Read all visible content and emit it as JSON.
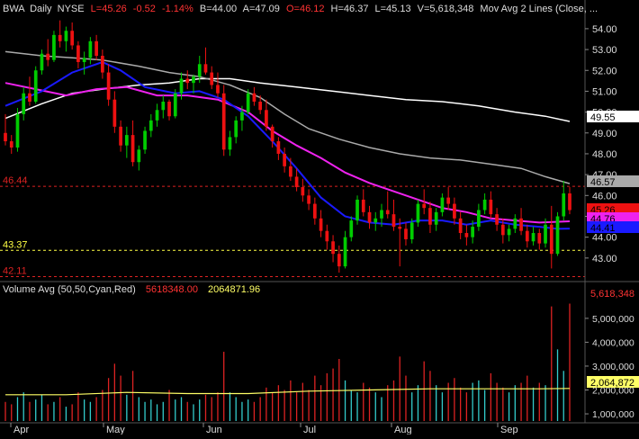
{
  "header": {
    "symbol": "BWA",
    "interval": "Daily",
    "exchange": "NYSE",
    "last": "L=45.26",
    "change": "-0.52",
    "change_pct": "-1.14%",
    "bid": "B=44.00",
    "ask": "A=47.09",
    "open": "O=46.12",
    "high": "H=46.37",
    "low": "L=45.13",
    "volume": "V=5,618,348",
    "study": "Mov Avg 2 Lines (Close, ..."
  },
  "volume_header": {
    "label": "Volume Avg (50,50,Cyan,Red)",
    "value1": "5618348.00",
    "value2": "2064871.96"
  },
  "colors": {
    "background": "#000000",
    "up_candle": "#00cc00",
    "down_candle": "#ee1111",
    "ma_blue": "#1a1aff",
    "ma_magenta": "#ee22ee",
    "ma_grey": "#aaaaaa",
    "ma_white": "#ffffff",
    "volume_up": "#33cccc",
    "volume_down": "#dd2222",
    "volume_avg": "#ffff66",
    "level_red": "#dd2222",
    "level_yellow": "#ffff44"
  },
  "chart_data": {
    "type": "candlestick",
    "price_axis": {
      "ylim": [
        42.0,
        54.6
      ],
      "ticks": [
        43,
        44,
        45,
        46,
        47,
        48,
        49,
        50,
        51,
        52,
        53,
        54
      ],
      "tick_labels": [
        "43.00",
        "44.00",
        "45.00",
        "46.00",
        "47.00",
        "48.00",
        "49.00",
        "50.00",
        "51.00",
        "52.00",
        "53.00",
        "54.00"
      ]
    },
    "x_axis": {
      "months": [
        "Apr",
        "May",
        "Jun",
        "Jul",
        "Aug",
        "Sep"
      ]
    },
    "level_lines": [
      {
        "value": 46.44,
        "label": "46.44",
        "color": "red"
      },
      {
        "value": 43.37,
        "label": "43.37",
        "color": "yellow"
      },
      {
        "value": 42.11,
        "label": "42.11",
        "color": "red"
      }
    ],
    "value_tags": [
      {
        "value": 49.55,
        "label": "49.55",
        "bg": "#ffffff",
        "fg": "#000000"
      },
      {
        "value": 46.57,
        "label": "46.57",
        "bg": "#aaaaaa",
        "fg": "#000000"
      },
      {
        "value": 45.26,
        "label": "45.26",
        "bg": "#ee1111",
        "fg": "#000000"
      },
      {
        "value": 44.76,
        "label": "44.76",
        "bg": "#ee22ee",
        "fg": "#000000"
      },
      {
        "value": 44.41,
        "label": "44.41",
        "bg": "#1a1aff",
        "fg": "#000000"
      }
    ],
    "candles_ohlc": [
      [
        49.0,
        49.9,
        48.4,
        48.6
      ],
      [
        48.6,
        48.9,
        48.0,
        48.3
      ],
      [
        48.3,
        50.2,
        48.1,
        49.9
      ],
      [
        49.9,
        51.2,
        49.6,
        50.9
      ],
      [
        50.9,
        51.7,
        50.3,
        50.5
      ],
      [
        50.5,
        52.2,
        50.4,
        52.0
      ],
      [
        52.0,
        53.0,
        51.8,
        52.8
      ],
      [
        52.8,
        53.5,
        52.2,
        52.5
      ],
      [
        52.5,
        53.9,
        52.4,
        53.7
      ],
      [
        53.7,
        54.4,
        53.1,
        53.4
      ],
      [
        53.4,
        54.1,
        52.9,
        53.9
      ],
      [
        53.9,
        54.3,
        53.0,
        53.2
      ],
      [
        53.2,
        53.4,
        52.1,
        52.4
      ],
      [
        52.4,
        52.9,
        51.8,
        52.6
      ],
      [
        52.6,
        53.6,
        52.3,
        53.4
      ],
      [
        53.4,
        53.7,
        52.5,
        52.7
      ],
      [
        52.7,
        53.0,
        51.6,
        51.9
      ],
      [
        51.9,
        52.3,
        50.3,
        50.6
      ],
      [
        50.6,
        51.0,
        49.0,
        49.3
      ],
      [
        49.3,
        49.6,
        48.1,
        48.4
      ],
      [
        48.4,
        49.3,
        47.8,
        48.9
      ],
      [
        48.9,
        49.6,
        47.4,
        47.6
      ],
      [
        47.6,
        48.4,
        47.2,
        48.2
      ],
      [
        48.2,
        49.3,
        48.0,
        49.1
      ],
      [
        49.1,
        49.9,
        48.8,
        49.6
      ],
      [
        49.6,
        50.4,
        49.3,
        50.1
      ],
      [
        50.1,
        50.8,
        49.7,
        50.5
      ],
      [
        50.5,
        50.6,
        49.6,
        49.8
      ],
      [
        49.8,
        51.1,
        49.7,
        50.9
      ],
      [
        50.9,
        51.9,
        50.6,
        51.6
      ],
      [
        51.6,
        52.0,
        51.1,
        51.4
      ],
      [
        51.4,
        51.8,
        50.9,
        51.7
      ],
      [
        51.7,
        52.7,
        51.4,
        52.3
      ],
      [
        52.3,
        53.1,
        51.8,
        51.9
      ],
      [
        51.9,
        52.2,
        51.1,
        51.3
      ],
      [
        51.3,
        51.9,
        50.7,
        50.9
      ],
      [
        50.9,
        51.3,
        47.9,
        48.2
      ],
      [
        48.2,
        49.1,
        47.9,
        48.8
      ],
      [
        48.8,
        49.8,
        48.5,
        49.6
      ],
      [
        49.6,
        50.3,
        49.1,
        50.0
      ],
      [
        50.0,
        51.1,
        49.9,
        50.9
      ],
      [
        50.9,
        51.2,
        50.3,
        50.5
      ],
      [
        50.5,
        50.8,
        49.9,
        50.1
      ],
      [
        50.1,
        50.6,
        49.1,
        49.3
      ],
      [
        49.3,
        49.4,
        48.3,
        48.6
      ],
      [
        48.6,
        48.8,
        47.7,
        48.0
      ],
      [
        48.0,
        48.3,
        47.1,
        47.4
      ],
      [
        47.4,
        47.8,
        46.7,
        46.9
      ],
      [
        46.9,
        47.3,
        46.2,
        46.4
      ],
      [
        46.4,
        46.8,
        45.7,
        46.0
      ],
      [
        46.0,
        46.3,
        45.3,
        45.6
      ],
      [
        45.6,
        45.9,
        44.6,
        44.9
      ],
      [
        44.9,
        45.3,
        44.0,
        44.3
      ],
      [
        44.3,
        44.6,
        43.4,
        43.8
      ],
      [
        43.8,
        44.1,
        42.8,
        43.2
      ],
      [
        43.2,
        43.6,
        42.3,
        42.6
      ],
      [
        42.6,
        44.3,
        42.5,
        44.0
      ],
      [
        44.0,
        45.0,
        43.8,
        44.8
      ],
      [
        44.8,
        46.0,
        44.6,
        45.8
      ],
      [
        45.8,
        46.3,
        45.0,
        45.2
      ],
      [
        45.2,
        45.5,
        44.4,
        44.7
      ],
      [
        44.7,
        45.2,
        44.3,
        44.9
      ],
      [
        44.9,
        45.6,
        44.5,
        45.3
      ],
      [
        45.3,
        46.2,
        44.9,
        45.1
      ],
      [
        45.1,
        45.8,
        44.3,
        44.5
      ],
      [
        44.5,
        44.9,
        42.6,
        44.4
      ],
      [
        44.4,
        44.7,
        43.6,
        43.9
      ],
      [
        43.9,
        44.9,
        43.7,
        44.7
      ],
      [
        44.7,
        45.8,
        44.5,
        45.6
      ],
      [
        45.6,
        46.3,
        45.1,
        45.4
      ],
      [
        45.4,
        45.7,
        44.2,
        44.6
      ],
      [
        44.6,
        45.4,
        44.3,
        45.2
      ],
      [
        45.2,
        46.1,
        45.0,
        45.9
      ],
      [
        45.9,
        46.4,
        45.3,
        45.6
      ],
      [
        45.6,
        45.9,
        44.6,
        44.9
      ],
      [
        44.9,
        45.2,
        43.9,
        44.2
      ],
      [
        44.2,
        44.6,
        43.6,
        44.0
      ],
      [
        44.0,
        44.8,
        43.7,
        44.5
      ],
      [
        44.5,
        45.6,
        44.3,
        45.3
      ],
      [
        45.3,
        46.1,
        45.1,
        45.8
      ],
      [
        45.8,
        46.2,
        44.9,
        45.1
      ],
      [
        45.1,
        45.4,
        44.3,
        44.6
      ],
      [
        44.6,
        44.9,
        43.7,
        44.1
      ],
      [
        44.1,
        44.6,
        43.8,
        44.4
      ],
      [
        44.4,
        45.1,
        44.2,
        44.9
      ],
      [
        44.9,
        45.4,
        44.1,
        44.3
      ],
      [
        44.3,
        44.6,
        43.5,
        43.8
      ],
      [
        43.8,
        44.5,
        43.6,
        44.2
      ],
      [
        44.2,
        44.4,
        43.4,
        43.7
      ],
      [
        43.7,
        44.9,
        43.5,
        44.6
      ],
      [
        44.6,
        45.5,
        42.5,
        43.2
      ],
      [
        43.2,
        45.2,
        43.1,
        45.0
      ],
      [
        45.0,
        46.7,
        44.8,
        46.1
      ],
      [
        46.1,
        46.4,
        45.1,
        45.3
      ]
    ],
    "ma_lines": {
      "blue": [
        [
          0,
          50.3
        ],
        [
          6,
          51.0
        ],
        [
          11,
          51.9
        ],
        [
          16,
          52.4
        ],
        [
          19,
          52.0
        ],
        [
          23,
          51.2
        ],
        [
          28,
          50.9
        ],
        [
          32,
          51.0
        ],
        [
          36,
          50.6
        ],
        [
          40,
          49.8
        ],
        [
          44,
          48.6
        ],
        [
          48,
          47.3
        ],
        [
          52,
          45.9
        ],
        [
          56,
          45.0
        ],
        [
          60,
          44.7
        ],
        [
          64,
          44.6
        ],
        [
          68,
          44.8
        ],
        [
          72,
          44.8
        ],
        [
          76,
          44.6
        ],
        [
          80,
          44.8
        ],
        [
          84,
          44.6
        ],
        [
          88,
          44.5
        ],
        [
          91,
          44.4
        ],
        [
          93,
          44.41
        ]
      ],
      "magenta": [
        [
          0,
          51.4
        ],
        [
          5,
          51.1
        ],
        [
          10,
          50.8
        ],
        [
          15,
          51.1
        ],
        [
          20,
          51.2
        ],
        [
          25,
          50.8
        ],
        [
          30,
          50.8
        ],
        [
          35,
          50.6
        ],
        [
          40,
          50.0
        ],
        [
          44,
          49.1
        ],
        [
          48,
          48.4
        ],
        [
          52,
          47.8
        ],
        [
          56,
          47.1
        ],
        [
          60,
          46.6
        ],
        [
          64,
          46.2
        ],
        [
          68,
          45.8
        ],
        [
          72,
          45.4
        ],
        [
          76,
          45.2
        ],
        [
          80,
          44.9
        ],
        [
          84,
          44.8
        ],
        [
          88,
          44.7
        ],
        [
          93,
          44.76
        ]
      ],
      "grey": [
        [
          0,
          52.9
        ],
        [
          6,
          52.7
        ],
        [
          11,
          52.6
        ],
        [
          16,
          52.5
        ],
        [
          22,
          52.2
        ],
        [
          27,
          51.9
        ],
        [
          32,
          51.7
        ],
        [
          37,
          51.3
        ],
        [
          42,
          50.7
        ],
        [
          46,
          49.9
        ],
        [
          50,
          49.2
        ],
        [
          55,
          48.7
        ],
        [
          60,
          48.3
        ],
        [
          65,
          48.0
        ],
        [
          70,
          47.8
        ],
        [
          75,
          47.7
        ],
        [
          80,
          47.5
        ],
        [
          85,
          47.3
        ],
        [
          89,
          46.9
        ],
        [
          93,
          46.57
        ]
      ],
      "white": [
        [
          0,
          49.7
        ],
        [
          6,
          50.4
        ],
        [
          11,
          50.9
        ],
        [
          16,
          51.1
        ],
        [
          22,
          51.3
        ],
        [
          27,
          51.4
        ],
        [
          32,
          51.6
        ],
        [
          37,
          51.6
        ],
        [
          42,
          51.4
        ],
        [
          48,
          51.2
        ],
        [
          54,
          51.0
        ],
        [
          60,
          50.8
        ],
        [
          66,
          50.6
        ],
        [
          72,
          50.5
        ],
        [
          78,
          50.3
        ],
        [
          84,
          50.0
        ],
        [
          89,
          49.8
        ],
        [
          93,
          49.55
        ]
      ]
    },
    "volume_axis": {
      "ylim": [
        700000,
        5900000
      ],
      "ticks": [
        1000000,
        2000000,
        3000000,
        4000000,
        5000000
      ],
      "tick_labels": [
        "1,000,000",
        "2,000,000",
        "3,000,000",
        "4,000,000",
        "5,000,000"
      ]
    },
    "volume_tags": [
      {
        "value": 5618348,
        "label": "5,618,348",
        "bg": "#000000",
        "fg": "#ff3333"
      },
      {
        "value": 2064872,
        "label": "2,064,872",
        "bg": "#ffff66",
        "fg": "#000000"
      }
    ],
    "volume": [
      1500000,
      1400000,
      1700000,
      1900000,
      1500000,
      1600000,
      1800000,
      1400000,
      1500000,
      1700000,
      1300000,
      1400000,
      1900000,
      1600000,
      1500000,
      1700000,
      2000000,
      2500000,
      3100000,
      2600000,
      1800000,
      2800000,
      1700000,
      1500000,
      1600000,
      1400000,
      1500000,
      2000000,
      1600000,
      1700000,
      1500000,
      1400000,
      1600000,
      1800000,
      1700000,
      1900000,
      3600000,
      1900000,
      1700000,
      1500000,
      1600000,
      1500000,
      1700000,
      2100000,
      1900000,
      2200000,
      2000000,
      2400000,
      1900000,
      2300000,
      2000000,
      2600000,
      2200000,
      2700000,
      2900000,
      3300000,
      2400000,
      2000000,
      1900000,
      2300000,
      2100000,
      1900000,
      1700000,
      2200000,
      2400000,
      3400000,
      2600000,
      1900000,
      2200000,
      3200000,
      2800000,
      2200000,
      1900000,
      2300000,
      2500000,
      2100000,
      1900000,
      2300000,
      2400000,
      2000000,
      2700000,
      2300000,
      2100000,
      1900000,
      2200000,
      2300000,
      2600000,
      2100000,
      2300000,
      2200000,
      5500000,
      3700000,
      2800000,
      5618348
    ],
    "volume_avg": [
      [
        0,
        1800000
      ],
      [
        10,
        1800000
      ],
      [
        20,
        1900000
      ],
      [
        30,
        1850000
      ],
      [
        40,
        1850000
      ],
      [
        50,
        1950000
      ],
      [
        60,
        2000000
      ],
      [
        70,
        2050000
      ],
      [
        80,
        2050000
      ],
      [
        88,
        2050000
      ],
      [
        93,
        2064872
      ]
    ]
  }
}
